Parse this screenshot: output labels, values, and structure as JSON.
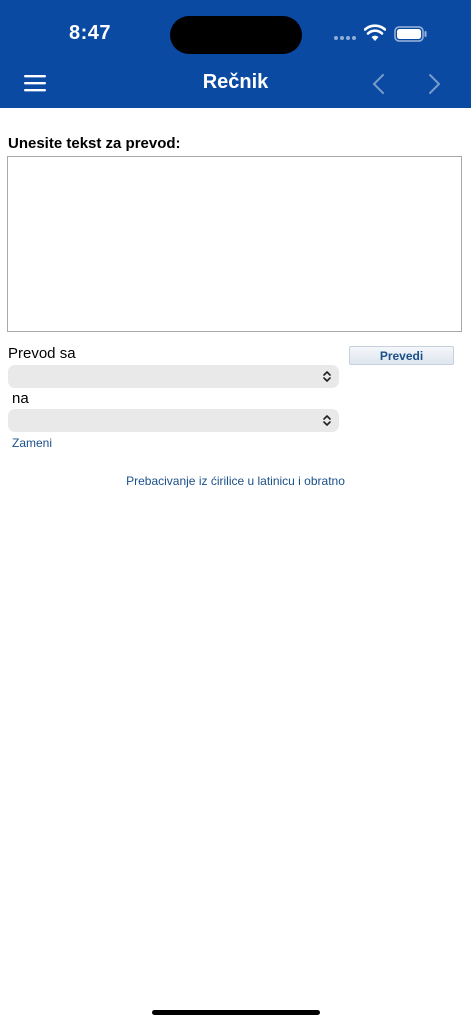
{
  "status_bar": {
    "time": "8:47"
  },
  "nav": {
    "title": "Rečnik"
  },
  "form": {
    "prompt_label": "Unesite tekst za prevod:",
    "text_value": "",
    "from_label": "Prevod sa",
    "from_value": "",
    "to_label": "na",
    "to_value": "",
    "translate_button": "Prevedi",
    "swap_link": "Zameni"
  },
  "links": {
    "script_toggle": "Prebacivanje iz ćirilice u latinicu i obratno"
  },
  "colors": {
    "nav_bar": "#0a4aa3",
    "link": "#1a4f8a",
    "select_bg": "#e9e9ea"
  },
  "icons": [
    "menu-icon",
    "chevron-left-icon",
    "chevron-right-icon",
    "wifi-icon",
    "battery-icon",
    "updown-icon"
  ]
}
